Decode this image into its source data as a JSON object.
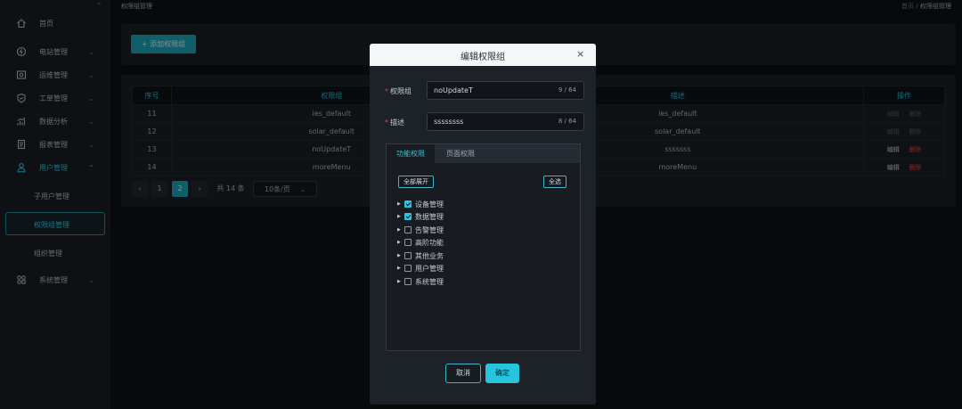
{
  "breadcrumb": {
    "title": "权限组管理",
    "home": "首页",
    "sep": "/",
    "current": "权限组管理"
  },
  "sidebar": {
    "collapse_glyph": "«",
    "items": [
      {
        "label": "首页",
        "icon": "home-icon"
      },
      {
        "label": "电站管理",
        "icon": "station-icon"
      },
      {
        "label": "运维管理",
        "icon": "maintenance-icon"
      },
      {
        "label": "工单管理",
        "icon": "shield-icon"
      },
      {
        "label": "数据分析",
        "icon": "chart-icon"
      },
      {
        "label": "报表管理",
        "icon": "report-icon"
      },
      {
        "label": "用户管理",
        "icon": "user-icon"
      },
      {
        "label": "系统管理",
        "icon": "apps-icon"
      }
    ],
    "sub_items": [
      "子用户管理",
      "权限组管理",
      "组织管理"
    ]
  },
  "toolbar": {
    "add_label": "+ 添加权限组"
  },
  "table": {
    "headers": [
      "序号",
      "权限组",
      "描述",
      "操作"
    ],
    "rows": [
      {
        "id": "11",
        "group": "ies_default",
        "desc": "ies_default"
      },
      {
        "id": "12",
        "group": "solar_default",
        "desc": "solar_default"
      },
      {
        "id": "13",
        "group": "noUpdateT",
        "desc": "sssssss"
      },
      {
        "id": "14",
        "group": "moreMenu",
        "desc": "moreMenu"
      }
    ],
    "edit_label": "编辑",
    "delete_label": "删除"
  },
  "pagination": {
    "prev": "‹",
    "next": "›",
    "pages": [
      "1",
      "2"
    ],
    "current": "2",
    "total": "共 14 条",
    "page_size": "10条/页"
  },
  "dialog": {
    "title": "编辑权限组",
    "close": "×",
    "group_label": "权限组",
    "group_value": "noUpdateT",
    "group_count": "9 / 64",
    "desc_label": "描述",
    "desc_value": "ssssssss",
    "desc_count": "8 / 64",
    "tabs": [
      "功能权限",
      "页面权限"
    ],
    "expand_all": "全部展开",
    "select_all": "全选",
    "tree": [
      {
        "label": "设备管理",
        "checked": true
      },
      {
        "label": "数据管理",
        "checked": true
      },
      {
        "label": "告警管理",
        "checked": false
      },
      {
        "label": "高阶功能",
        "checked": false
      },
      {
        "label": "其他业务",
        "checked": false
      },
      {
        "label": "用户管理",
        "checked": false
      },
      {
        "label": "系统管理",
        "checked": false
      }
    ],
    "cancel": "取消",
    "confirm": "确定"
  },
  "colors": {
    "accent": "#27c4dd",
    "danger": "#e04343",
    "background": "#0e1114",
    "panel": "#1b1f24"
  }
}
